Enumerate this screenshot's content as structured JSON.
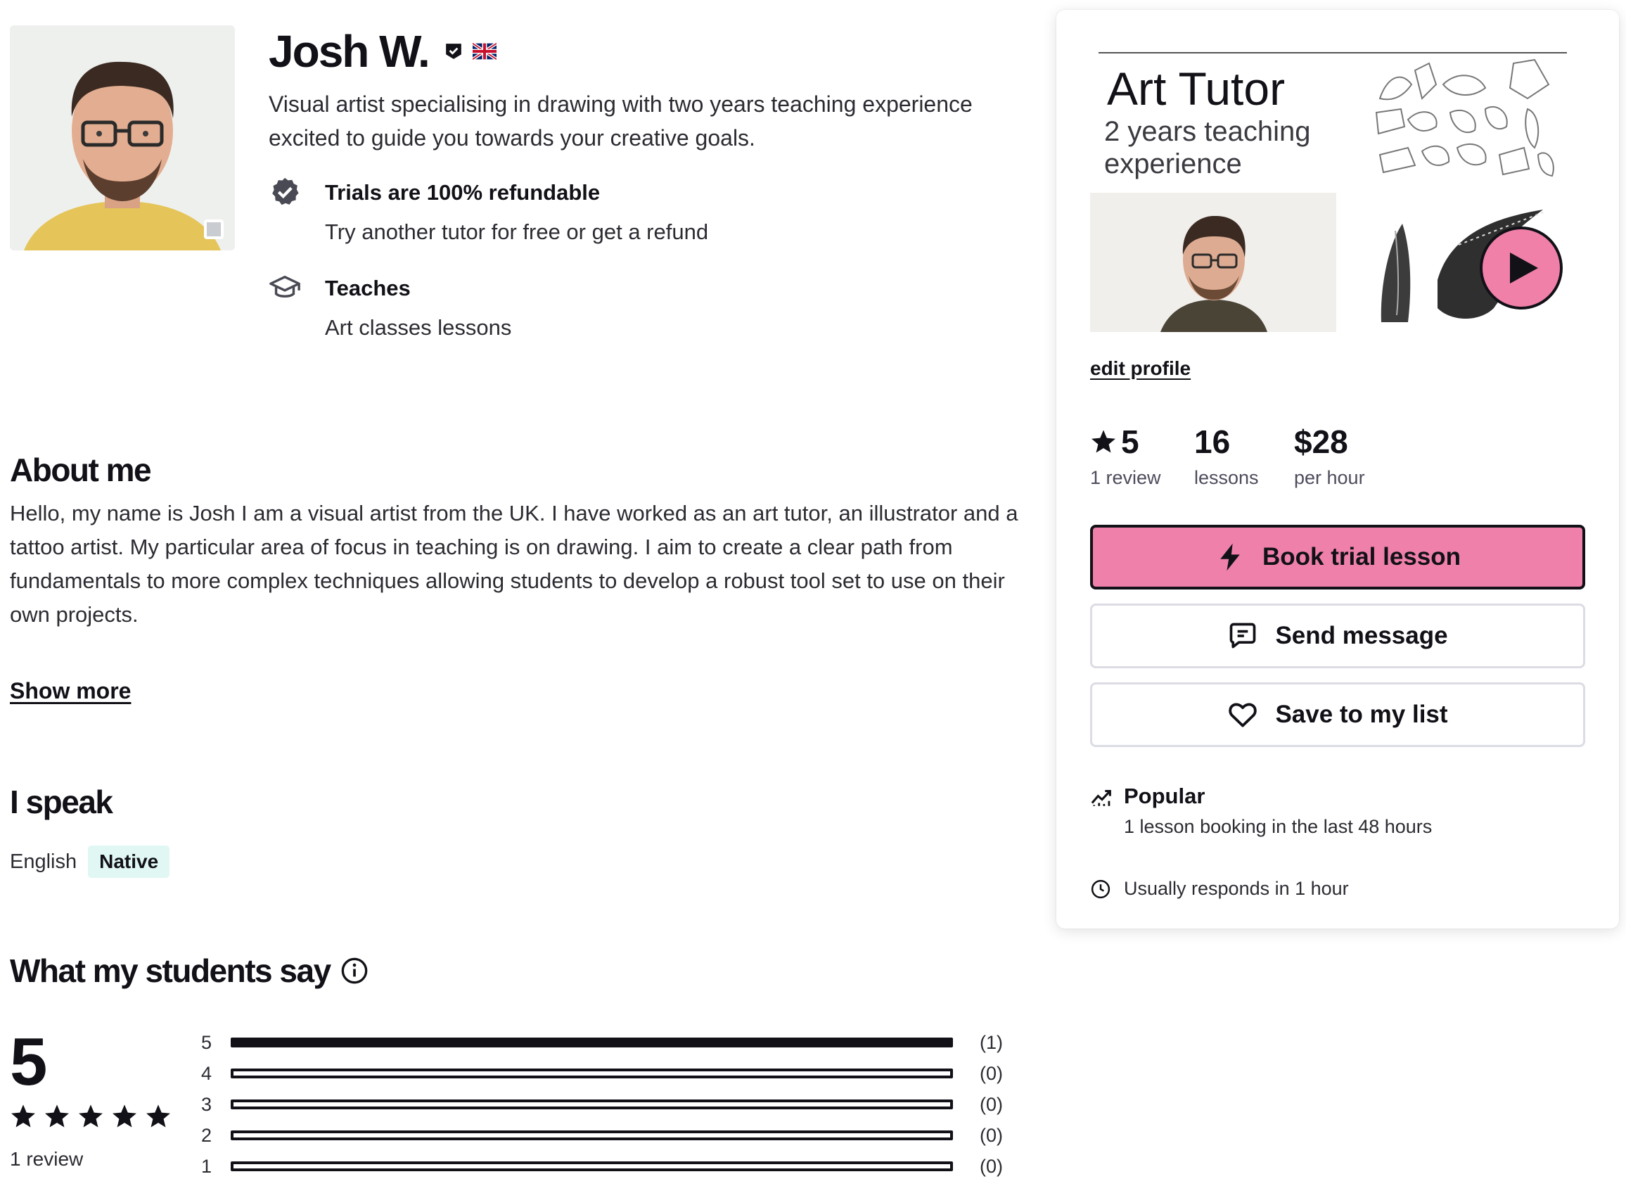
{
  "tutor": {
    "name": "Josh W.",
    "headline": "Visual artist specialising in drawing with two years teaching experience excited to guide you towards your creative goals."
  },
  "features": {
    "trial_title": "Trials are 100% refundable",
    "trial_sub": "Try another tutor for free or get a refund",
    "teaches_title": "Teaches",
    "teaches_sub": "Art classes lessons"
  },
  "about": {
    "heading": "About me",
    "text": "Hello, my name is Josh I am a visual artist from the UK. I have worked as an art tutor, an illustrator and a tattoo artist. My particular area of focus in teaching is on drawing. I aim to create a clear path from fundamentals to more complex techniques allowing students to develop a robust tool set to use on their own projects.",
    "show_more": "Show more"
  },
  "languages": {
    "heading": "I speak",
    "items": [
      {
        "name": "English",
        "level": "Native"
      }
    ]
  },
  "reviews": {
    "heading": "What my students say",
    "average": "5",
    "count_label": "1 review",
    "stars": 5,
    "breakdown": [
      {
        "stars": "5",
        "count": "(1)",
        "fraction": 1
      },
      {
        "stars": "4",
        "count": "(0)",
        "fraction": 0
      },
      {
        "stars": "3",
        "count": "(0)",
        "fraction": 0
      },
      {
        "stars": "2",
        "count": "(0)",
        "fraction": 0
      },
      {
        "stars": "1",
        "count": "(0)",
        "fraction": 0
      }
    ]
  },
  "card": {
    "video_title": "Art Tutor",
    "video_subtitle": "2 years teaching experience",
    "edit_profile": "edit profile",
    "stats": {
      "rating_value": "5",
      "rating_label": "1 review",
      "lessons_value": "16",
      "lessons_label": "lessons",
      "price_value": "$28",
      "price_label": "per hour"
    },
    "buttons": {
      "trial": "Book trial lesson",
      "message": "Send message",
      "save": "Save to my list"
    },
    "popular_title": "Popular",
    "popular_sub": "1 lesson booking in the last 48 hours",
    "responds": "Usually responds in 1 hour"
  },
  "colors": {
    "accent_pink": "#ef80aa",
    "text": "#121117",
    "native_badge": "#e0f7f4"
  },
  "icons": [
    "verified-icon",
    "uk-flag-icon",
    "shield-check-icon",
    "graduation-cap-icon",
    "info-icon",
    "star-icon",
    "play-icon",
    "lightning-icon",
    "message-icon",
    "heart-icon",
    "trending-icon",
    "clock-icon"
  ]
}
